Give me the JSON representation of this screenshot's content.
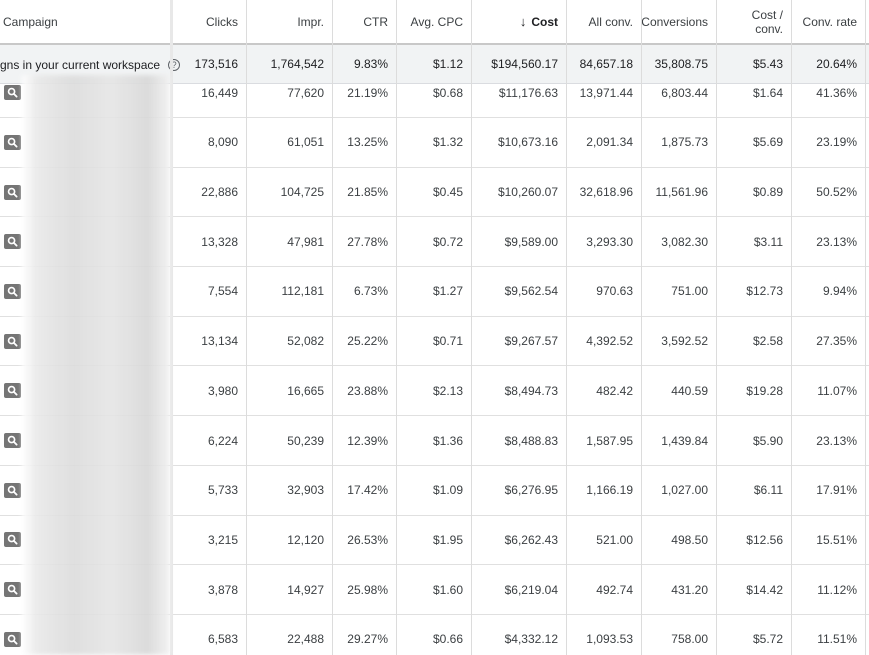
{
  "header": {
    "columns": [
      "Campaign",
      "Clicks",
      "Impr.",
      "CTR",
      "Avg. CPC",
      "Cost",
      "All conv.",
      "Conversions",
      "Cost / conv.",
      "Conv. rate"
    ],
    "cost_sort_arrow": "↓",
    "cost_per_conv_line1": "Cost /",
    "cost_per_conv_line2": "conv."
  },
  "totals": {
    "label": "gns in your current workspace",
    "values": [
      "173,516",
      "1,764,542",
      "9.83%",
      "$1.12",
      "$194,560.17",
      "84,657.18",
      "35,808.75",
      "$5.43",
      "20.64%"
    ]
  },
  "rows": [
    [
      "16,449",
      "77,620",
      "21.19%",
      "$0.68",
      "$11,176.63",
      "13,971.44",
      "6,803.44",
      "$1.64",
      "41.36%"
    ],
    [
      "8,090",
      "61,051",
      "13.25%",
      "$1.32",
      "$10,673.16",
      "2,091.34",
      "1,875.73",
      "$5.69",
      "23.19%"
    ],
    [
      "22,886",
      "104,725",
      "21.85%",
      "$0.45",
      "$10,260.07",
      "32,618.96",
      "11,561.96",
      "$0.89",
      "50.52%"
    ],
    [
      "13,328",
      "47,981",
      "27.78%",
      "$0.72",
      "$9,589.00",
      "3,293.30",
      "3,082.30",
      "$3.11",
      "23.13%"
    ],
    [
      "7,554",
      "112,181",
      "6.73%",
      "$1.27",
      "$9,562.54",
      "970.63",
      "751.00",
      "$12.73",
      "9.94%"
    ],
    [
      "13,134",
      "52,082",
      "25.22%",
      "$0.71",
      "$9,267.57",
      "4,392.52",
      "3,592.52",
      "$2.58",
      "27.35%"
    ],
    [
      "3,980",
      "16,665",
      "23.88%",
      "$2.13",
      "$8,494.73",
      "482.42",
      "440.59",
      "$19.28",
      "11.07%"
    ],
    [
      "6,224",
      "50,239",
      "12.39%",
      "$1.36",
      "$8,488.83",
      "1,587.95",
      "1,439.84",
      "$5.90",
      "23.13%"
    ],
    [
      "5,733",
      "32,903",
      "17.42%",
      "$1.09",
      "$6,276.95",
      "1,166.19",
      "1,027.00",
      "$6.11",
      "17.91%"
    ],
    [
      "3,215",
      "12,120",
      "26.53%",
      "$1.95",
      "$6,262.43",
      "521.00",
      "498.50",
      "$12.56",
      "15.51%"
    ],
    [
      "3,878",
      "14,927",
      "25.98%",
      "$1.60",
      "$6,219.04",
      "492.74",
      "431.20",
      "$14.42",
      "11.12%"
    ],
    [
      "6,583",
      "22,488",
      "29.27%",
      "$0.66",
      "$4,332.12",
      "1,093.53",
      "758.00",
      "$5.72",
      "11.51%"
    ]
  ],
  "icons": {
    "row_action": "search-icon",
    "help": "help-circle-icon",
    "sort": "arrow-down-icon"
  }
}
